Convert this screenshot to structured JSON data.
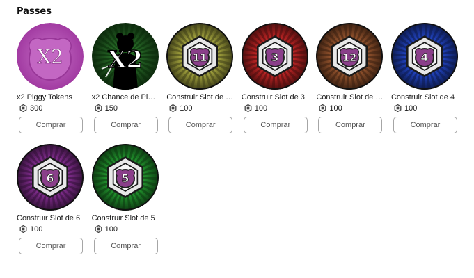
{
  "section": {
    "title": "Passes"
  },
  "passes": [
    {
      "name": "x2 Piggy Tokens",
      "price": "300",
      "button": "Comprar",
      "icon": "x2-piggy-tokens-icon",
      "style": "x2pink",
      "color": "#b441b4"
    },
    {
      "name": "x2 Chance de Piggy",
      "price": "150",
      "button": "Comprar",
      "icon": "x2-chance-piggy-icon",
      "style": "x2green",
      "color": "#41b441"
    },
    {
      "name": "Construir Slot de 11",
      "price": "100",
      "button": "Comprar",
      "icon": "slot-11-icon",
      "style": "slot",
      "badge": "11",
      "color": "#9a9a3a"
    },
    {
      "name": "Construir Slot de 3",
      "price": "100",
      "button": "Comprar",
      "icon": "slot-3-icon",
      "style": "slot",
      "badge": "3",
      "color": "#b22222"
    },
    {
      "name": "Construir Slot de 12",
      "price": "100",
      "button": "Comprar",
      "icon": "slot-12-icon",
      "style": "slot",
      "badge": "12",
      "color": "#8b4e2a"
    },
    {
      "name": "Construir Slot de 4",
      "price": "100",
      "button": "Comprar",
      "icon": "slot-4-icon",
      "style": "slot",
      "badge": "4",
      "color": "#1f3fb4"
    },
    {
      "name": "Construir Slot de 6",
      "price": "100",
      "button": "Comprar",
      "icon": "slot-6-icon",
      "style": "slot",
      "badge": "6",
      "color": "#7a2a86"
    },
    {
      "name": "Construir Slot de 5",
      "price": "100",
      "button": "Comprar",
      "icon": "slot-5-icon",
      "style": "slot",
      "badge": "5",
      "color": "#1f8a2a"
    }
  ]
}
